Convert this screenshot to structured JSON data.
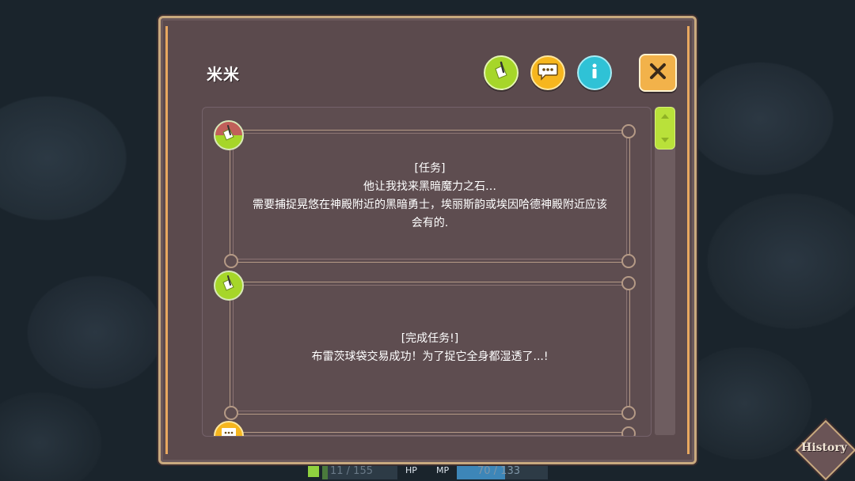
{
  "panel": {
    "title": "米米",
    "header_buttons": [
      {
        "icon": "quest-note-icon",
        "color": "#a6d629"
      },
      {
        "icon": "chat-bubble-icon",
        "color": "#f6b61e"
      },
      {
        "icon": "info-icon",
        "color": "#2fc2d6"
      }
    ],
    "close_icon": "close-icon"
  },
  "entries": [
    {
      "icon": "quest-note-icon",
      "lines": [
        "[任务]",
        "他让我找来黑暗魔力之石…",
        "需要捕捉晃悠在神殿附近的黑暗勇士，埃丽斯韵或埃因哈德神殿附近应该会有的."
      ]
    },
    {
      "icon": "quest-note-icon",
      "lines": [
        "[完成任务!]",
        "布雷茨球袋交易成功！为了捉它全身都湿透了...!"
      ]
    },
    {
      "icon": "chat-bubble-icon",
      "lines": []
    }
  ],
  "hud": {
    "hp_value": "11 / 155",
    "hp_label": "HP",
    "mp_label": "MP",
    "mp_value": "70 / 133",
    "hp_fraction": 0.07,
    "mp_fraction": 0.53
  },
  "history_label": "History",
  "colors": {
    "panel_bg": "#5b4a4d",
    "panel_border": "#c8a97e",
    "accent_orange": "#e8a860",
    "scroll_thumb": "#b9e13a"
  }
}
